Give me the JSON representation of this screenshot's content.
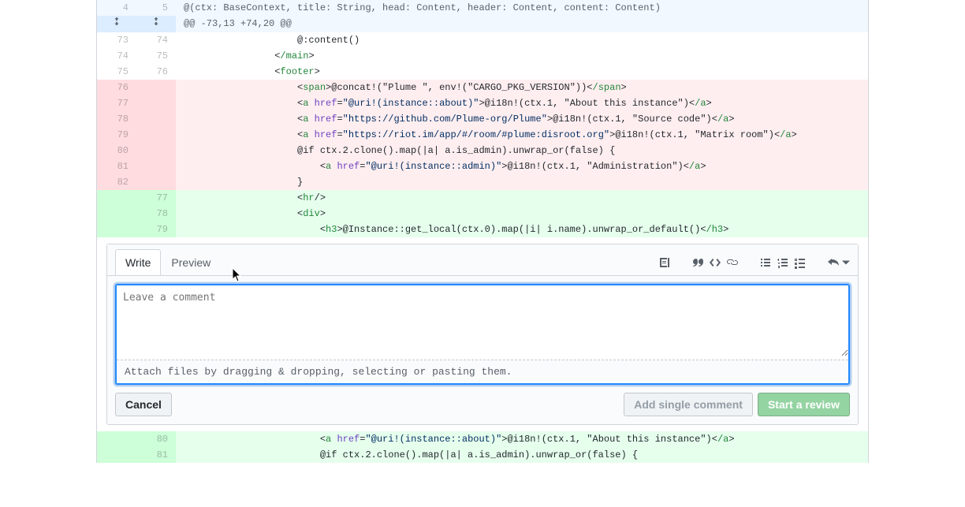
{
  "hunk": {
    "header_line": "@(ctx: BaseContext, title: String, head: Content, header: Content, content: Content)",
    "header_old": "4",
    "header_new": "5",
    "hunk_info": "@@ -73,13 +74,20 @@"
  },
  "rows": [
    {
      "type": "ctx",
      "old": "73",
      "new": "74",
      "html": "                    @:content()"
    },
    {
      "type": "ctx",
      "old": "74",
      "new": "75",
      "html": "                <<span class='tag'>/main</span>>"
    },
    {
      "type": "ctx",
      "old": "75",
      "new": "76",
      "html": "                <<span class='tag'>footer</span>>"
    },
    {
      "type": "del",
      "old": "76",
      "new": "",
      "html": "                    <<span class='tag'>span</span>>@concat!(\"Plume \", env!(\"CARGO_PKG_VERSION\"))<<span class='tag'>/span</span>>"
    },
    {
      "type": "del",
      "old": "77",
      "new": "",
      "html": "                    <<span class='tag'>a</span> <span class='attr'>href</span>=<span class='str'>\"@uri!(instance::about)\"</span>>@i18n!(ctx.1, \"About this instance\")<<span class='tag'>/a</span>>"
    },
    {
      "type": "del",
      "old": "78",
      "new": "",
      "html": "                    <<span class='tag'>a</span> <span class='attr'>href</span>=<span class='str'>\"https://github.com/Plume-org/Plume\"</span>>@i18n!(ctx.1, \"Source code\")<<span class='tag'>/a</span>>"
    },
    {
      "type": "del",
      "old": "79",
      "new": "",
      "html": "                    <<span class='tag'>a</span> <span class='attr'>href</span>=<span class='str'>\"https://riot.im/app/#/room/#plume:disroot.org\"</span>>@i18n!(ctx.1, \"Matrix room\")<<span class='tag'>/a</span>>"
    },
    {
      "type": "del",
      "old": "80",
      "new": "",
      "html": "                    @if ctx.2.clone().map(|a| a.is_admin).unwrap_or(false) {"
    },
    {
      "type": "del",
      "old": "81",
      "new": "",
      "html": "                        <<span class='tag'>a</span> <span class='attr'>href</span>=<span class='str'>\"@uri!(instance::admin)\"</span>>@i18n!(ctx.1, \"Administration\")<<span class='tag'>/a</span>>"
    },
    {
      "type": "del",
      "old": "82",
      "new": "",
      "html": "                    }"
    },
    {
      "type": "add",
      "old": "",
      "new": "77",
      "html": "                    <<span class='tag'>hr</span>/>"
    },
    {
      "type": "add",
      "old": "",
      "new": "78",
      "html": "                    <<span class='tag'>div</span>>"
    },
    {
      "type": "add",
      "old": "",
      "new": "79",
      "html": "                        <<span class='tag'>h3</span>>@Instance::get_local(ctx.0).map(|i| i.name).unwrap_or_default()<<span class='tag'>/h3</span>>"
    }
  ],
  "rows_after": [
    {
      "type": "add",
      "old": "",
      "new": "80",
      "html": "                        <<span class='tag'>a</span> <span class='attr'>href</span>=<span class='str'>\"@uri!(instance::about)\"</span>>@i18n!(ctx.1, \"About this instance\")<<span class='tag'>/a</span>>"
    },
    {
      "type": "add",
      "old": "",
      "new": "81",
      "html": "                        @if ctx.2.clone().map(|a| a.is_admin).unwrap_or(false) {"
    }
  ],
  "comment": {
    "tabs": {
      "write": "Write",
      "preview": "Preview"
    },
    "placeholder": "Leave a comment",
    "drag_hint": "Attach files by dragging & dropping, selecting or pasting them.",
    "cancel": "Cancel",
    "add_single": "Add single comment",
    "start_review": "Start a review"
  }
}
